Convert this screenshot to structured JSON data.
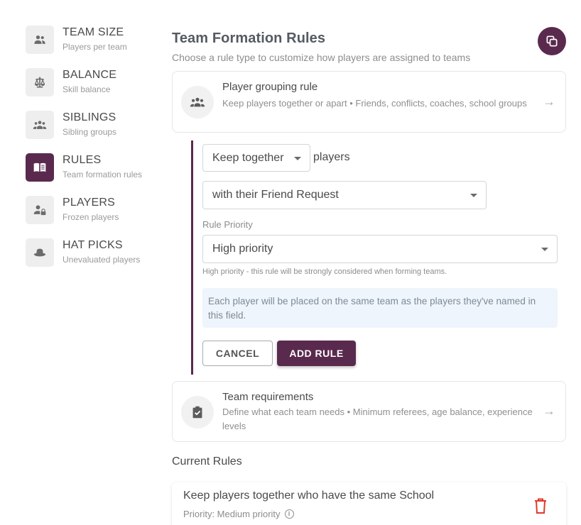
{
  "sidebar": {
    "items": [
      {
        "title": "TEAM SIZE",
        "sub": "Players per team",
        "icon": "team-size-icon"
      },
      {
        "title": "BALANCE",
        "sub": "Skill balance",
        "icon": "balance-scale-icon"
      },
      {
        "title": "SIBLINGS",
        "sub": "Sibling groups",
        "icon": "siblings-group-icon"
      },
      {
        "title": "RULES",
        "sub": "Team formation rules",
        "icon": "rules-book-icon",
        "active": true
      },
      {
        "title": "PLAYERS",
        "sub": "Frozen players",
        "icon": "frozen-player-lock-icon"
      },
      {
        "title": "HAT PICKS",
        "sub": "Unevaluated players",
        "icon": "hat-icon"
      }
    ]
  },
  "header": {
    "title": "Team Formation Rules",
    "subtitle": "Choose a rule type to customize how players are assigned to teams",
    "copy_icon": "copy-icon"
  },
  "cards": {
    "grouping": {
      "title": "Player grouping rule",
      "desc": "Keep players together or apart • Friends, conflicts, coaches, school groups",
      "icon": "people-group-icon",
      "arrow": "→"
    },
    "requirements": {
      "title": "Team requirements",
      "desc": "Define what each team needs • Minimum referees, age balance, experience levels",
      "icon": "clipboard-check-icon",
      "arrow": "→"
    }
  },
  "form": {
    "mode_value": "Keep together",
    "mode_suffix": "players",
    "relation_value": "with their Friend Request",
    "priority_label": "Rule Priority",
    "priority_value": "High priority",
    "priority_helper": "High priority - this rule will be strongly considered when forming teams.",
    "info": "Each player will be placed on the same team as the players they've named in this field.",
    "cancel_label": "CANCEL",
    "add_label": "ADD RULE"
  },
  "current_rules": {
    "title": "Current Rules",
    "items": [
      {
        "title": "Keep players together who have the same School",
        "priority": "Priority: Medium priority",
        "info_glyph": "i",
        "delete_icon": "trash-icon"
      }
    ]
  },
  "colors": {
    "accent": "#5a2a4e",
    "danger": "#e0392b",
    "info_bg": "#eef5fc"
  }
}
